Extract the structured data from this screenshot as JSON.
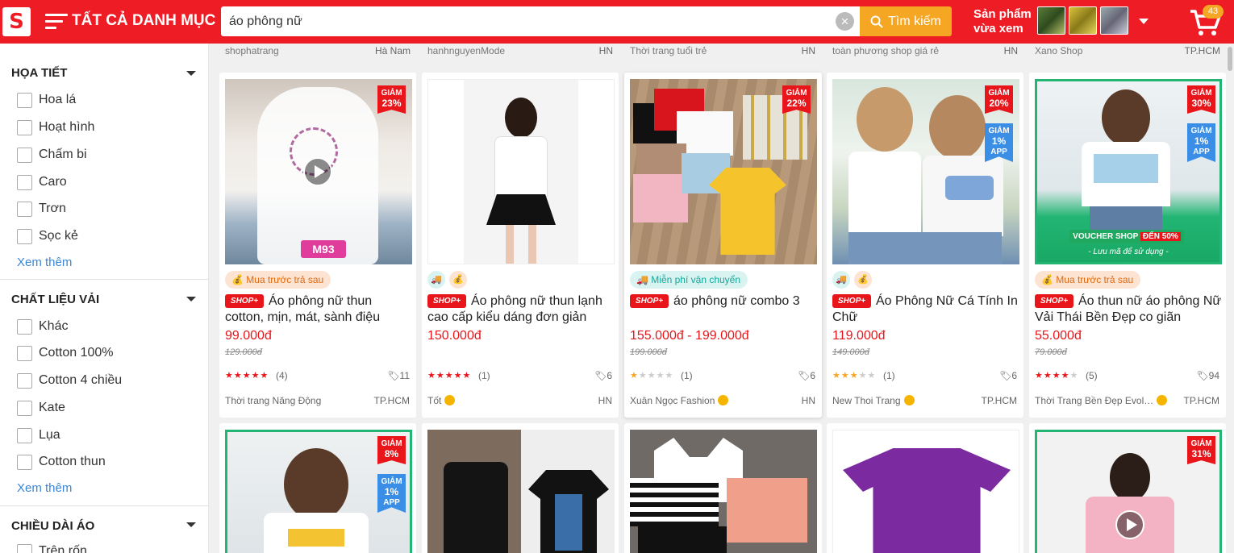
{
  "header": {
    "logo_text": "S",
    "categories_label": "TẤT CẢ DANH MỤC",
    "search_value": "áo phông nữ",
    "search_button": "Tìm kiếm",
    "recent_line1": "Sản phẩm",
    "recent_line2": "vừa xem",
    "cart_count": "43",
    "brand_color": "#ee1c25",
    "accent_color": "#f5a623"
  },
  "sidebar": {
    "sections": [
      {
        "title": "HỌA TIẾT",
        "options": [
          "Hoa lá",
          "Hoạt hình",
          "Chấm bi",
          "Caro",
          "Trơn",
          "Sọc kẻ"
        ],
        "more": "Xem thêm"
      },
      {
        "title": "CHẤT LIỆU VẢI",
        "options": [
          "Khác",
          "Cotton 100%",
          "Cotton 4 chiều",
          "Kate",
          "Lụa",
          "Cotton thun"
        ],
        "more": "Xem thêm"
      },
      {
        "title": "CHIỀU DÀI ÁO",
        "options": [
          "Trên rốn"
        ]
      }
    ]
  },
  "top_row": [
    {
      "shop": "shophatrang",
      "loc": "Hà Nam"
    },
    {
      "shop": "hanhnguyenMode",
      "loc": "HN"
    },
    {
      "shop": "Thời trang tuổi trẻ",
      "loc": "HN"
    },
    {
      "shop": "toàn phương shop giá rẻ",
      "loc": "HN"
    },
    {
      "shop": "Xano Shop",
      "loc": "TP.HCM"
    }
  ],
  "products": [
    {
      "tag": "Mua trước trả sau",
      "title": "Áo phông nữ thun cotton, mịn, mát, sành điệu",
      "price": "99.000đ",
      "old_price": "129.000đ",
      "rating": 5,
      "reviews": "(4)",
      "likes": "11",
      "shop": "Thời trang Năng Động",
      "loc": "TP.HCM",
      "disc_label": "GIẢM",
      "discount": "23%",
      "overlay": "M93"
    },
    {
      "tag": "",
      "title": "Áo phông nữ thun lạnh cao cấp kiểu dáng đơn giản",
      "price": "150.000đ",
      "old_price": "",
      "rating": 5,
      "reviews": "(1)",
      "likes": "6",
      "shop": "Tốt",
      "loc": "HN"
    },
    {
      "tag": "Miễn phí vận chuyển",
      "title": "áo phông nữ combo 3",
      "price": "155.000đ - 199.000đ",
      "old_price": "199.000đ",
      "rating": 1,
      "reviews": "(1)",
      "likes": "6",
      "shop": "Xuân Ngọc Fashion",
      "loc": "HN",
      "disc_label": "GIẢM",
      "discount": "22%"
    },
    {
      "tag": "",
      "title": "Áo Phông Nữ Cá Tính In Chữ",
      "price": "119.000đ",
      "old_price": "149.000đ",
      "rating": 3,
      "reviews": "(1)",
      "likes": "6",
      "shop": "New Thoi Trang",
      "loc": "TP.HCM",
      "disc_label": "GIẢM",
      "discount": "20%",
      "app_discount": "1%",
      "app_label": "APP"
    },
    {
      "tag": "Mua trước trả sau",
      "title": "Áo thun nữ áo phông Nữ Vải Thái Bền Đẹp co giãn thoản…",
      "price": "55.000đ",
      "old_price": "79.000đ",
      "rating": 4,
      "reviews": "(5)",
      "likes": "94",
      "shop": "Thời Trang Bền Đẹp Evol…",
      "loc": "TP.HCM",
      "disc_label": "GIẢM",
      "discount": "30%",
      "app_discount": "1%",
      "app_label": "APP",
      "voucher_a": "VOUCHER SHOP",
      "voucher_b": "ĐẾN 50%",
      "voucher_note": "- Lưu mã để sử dụng -"
    }
  ],
  "row2": [
    {
      "disc_label": "GIẢM",
      "discount": "8%",
      "app_discount": "1%",
      "app_label": "APP"
    },
    {},
    {},
    {},
    {
      "disc_label": "GIẢM",
      "discount": "31%"
    }
  ],
  "shop_badge": "SHOP+"
}
